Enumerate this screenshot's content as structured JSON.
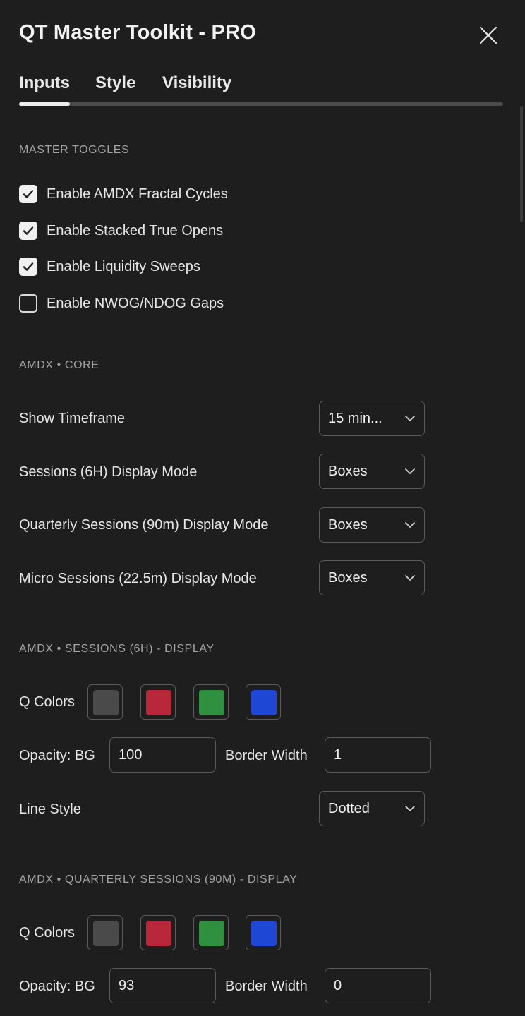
{
  "header": {
    "title": "QT Master Toolkit - PRO",
    "close_icon": "close-icon"
  },
  "tabs": [
    {
      "label": "Inputs",
      "active": true
    },
    {
      "label": "Style",
      "active": false
    },
    {
      "label": "Visibility",
      "active": false
    }
  ],
  "master_toggles": {
    "heading": "MASTER TOGGLES",
    "items": [
      {
        "label": "Enable AMDX Fractal Cycles",
        "checked": true
      },
      {
        "label": "Enable Stacked True Opens",
        "checked": true
      },
      {
        "label": "Enable Liquidity Sweeps",
        "checked": true
      },
      {
        "label": "Enable NWOG/NDOG Gaps",
        "checked": false
      }
    ]
  },
  "core": {
    "heading": "AMDX • CORE",
    "rows": [
      {
        "label": "Show Timeframe",
        "value": "15 min..."
      },
      {
        "label": "Sessions (6H) Display Mode",
        "value": "Boxes"
      },
      {
        "label": "Quarterly Sessions (90m) Display Mode",
        "value": "Boxes"
      },
      {
        "label": "Micro Sessions (22.5m) Display Mode",
        "value": "Boxes"
      }
    ]
  },
  "sessions_display": {
    "heading": "AMDX • SESSIONS (6H) - DISPLAY",
    "colors_label": "Q Colors",
    "colors": [
      "#4a4a4a",
      "#b8283a",
      "#2f9140",
      "#1f47d6"
    ],
    "opacity_label": "Opacity: BG",
    "opacity_value": "100",
    "border_label": "Border Width",
    "border_value": "1",
    "line_style_label": "Line Style",
    "line_style_value": "Dotted"
  },
  "quarterly_display": {
    "heading": "AMDX • QUARTERLY SESSIONS (90M) - DISPLAY",
    "colors_label": "Q Colors",
    "colors": [
      "#4a4a4a",
      "#b8283a",
      "#2f9140",
      "#1f47d6"
    ],
    "opacity_label": "Opacity: BG",
    "opacity_value": "93",
    "border_label": "Border Width",
    "border_value": "0"
  }
}
